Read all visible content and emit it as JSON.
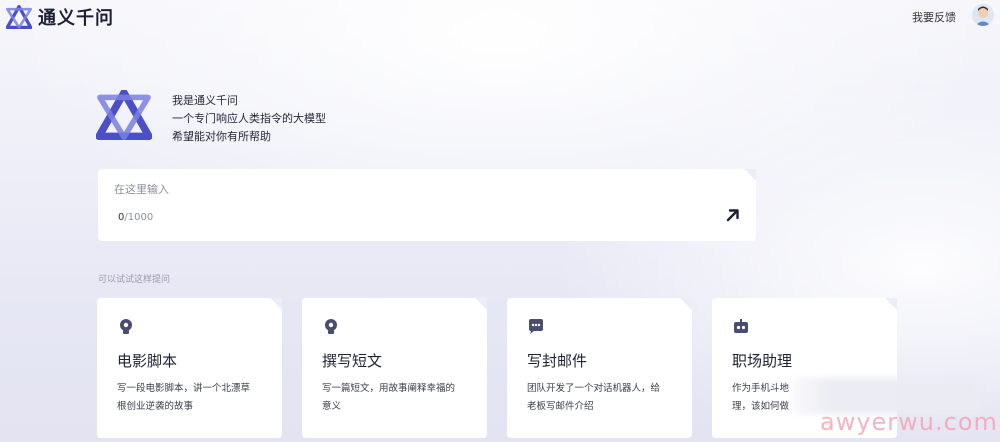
{
  "header": {
    "app_name": "通义千问",
    "feedback_label": "我要反馈"
  },
  "intro": {
    "line1": "我是通义千问",
    "line2": "一个专门响应人类指令的大模型",
    "line3": "希望能对你有所帮助"
  },
  "input": {
    "placeholder": "在这里输入",
    "count": "0",
    "max": "/1000"
  },
  "suggestions": {
    "title": "可以试试这样提问",
    "cards": [
      {
        "title": "电影脚本",
        "desc1": "写一段电影脚本，讲一个北漂草",
        "desc2": "根创业逆袭的故事",
        "icon": "lightbulb-icon"
      },
      {
        "title": "撰写短文",
        "desc1": "写一篇短文，用故事阐释幸福的",
        "desc2": "意义",
        "icon": "lightbulb-icon"
      },
      {
        "title": "写封邮件",
        "desc1": "团队开发了一个对话机器人，给",
        "desc2": "老板写邮件介绍",
        "icon": "chat-bubble-icon"
      },
      {
        "title": "职场助理",
        "desc1": "作为手机斗地",
        "desc2": "理，该如何做",
        "icon": "robot-icon"
      }
    ]
  },
  "watermark": "awyerwu.com",
  "colors": {
    "brand": "#4a4fc7",
    "brand_light": "#7a7fe0",
    "background": "#eceef7"
  }
}
